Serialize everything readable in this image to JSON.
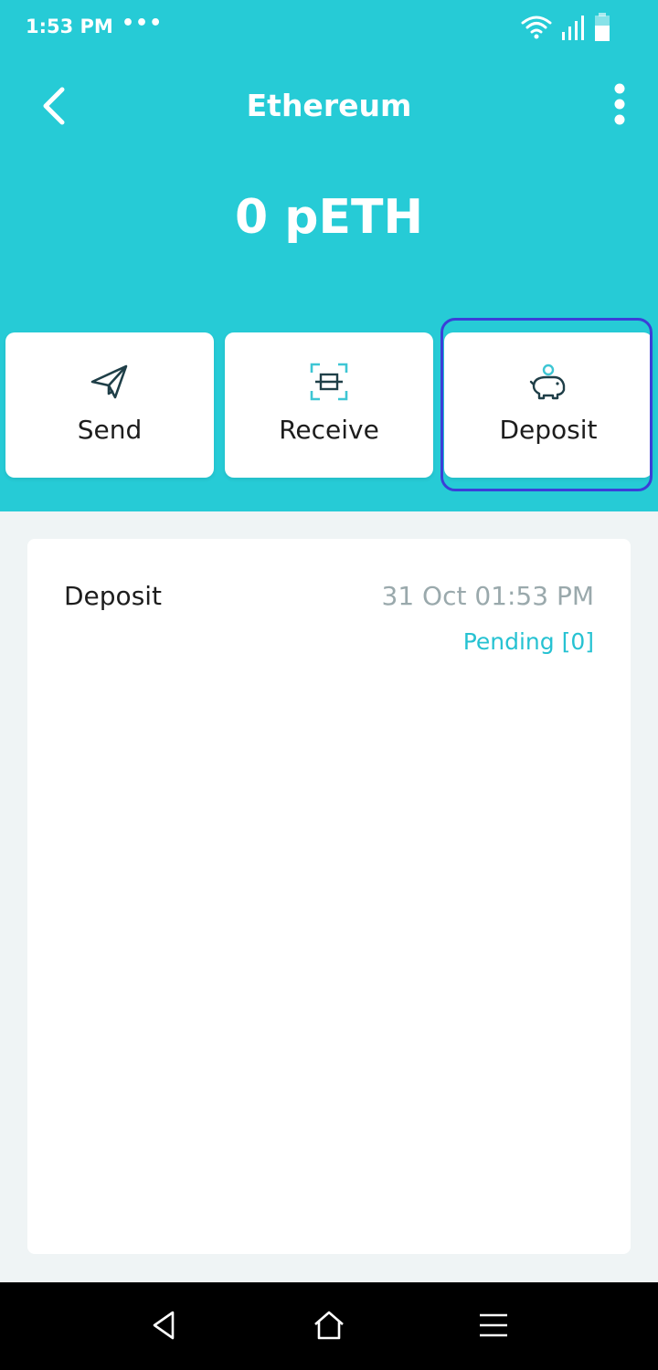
{
  "status_bar": {
    "time": "1:53 PM",
    "overflow": "•••",
    "icons": [
      "wifi-icon",
      "signal-icon",
      "battery-icon"
    ]
  },
  "app_bar": {
    "title": "Ethereum",
    "back_icon": "chevron-left-icon",
    "more_icon": "more-vertical-icon"
  },
  "balance": "0 pETH",
  "actions": [
    {
      "label": "Send",
      "icon": "paper-plane-icon"
    },
    {
      "label": "Receive",
      "icon": "scan-icon"
    },
    {
      "label": "Deposit",
      "icon": "piggy-bank-icon"
    }
  ],
  "transactions": [
    {
      "type": "Deposit",
      "date": "31 Oct 01:53 PM",
      "status": "Pending [0]"
    }
  ],
  "nav_bar": {
    "icons": [
      "nav-back-icon",
      "nav-home-icon",
      "nav-menu-icon"
    ]
  },
  "colors": {
    "header": "#26cbd6",
    "accent": "#26c2d2",
    "focus_ring": "#3b3fd8",
    "background": "#eff4f5"
  }
}
